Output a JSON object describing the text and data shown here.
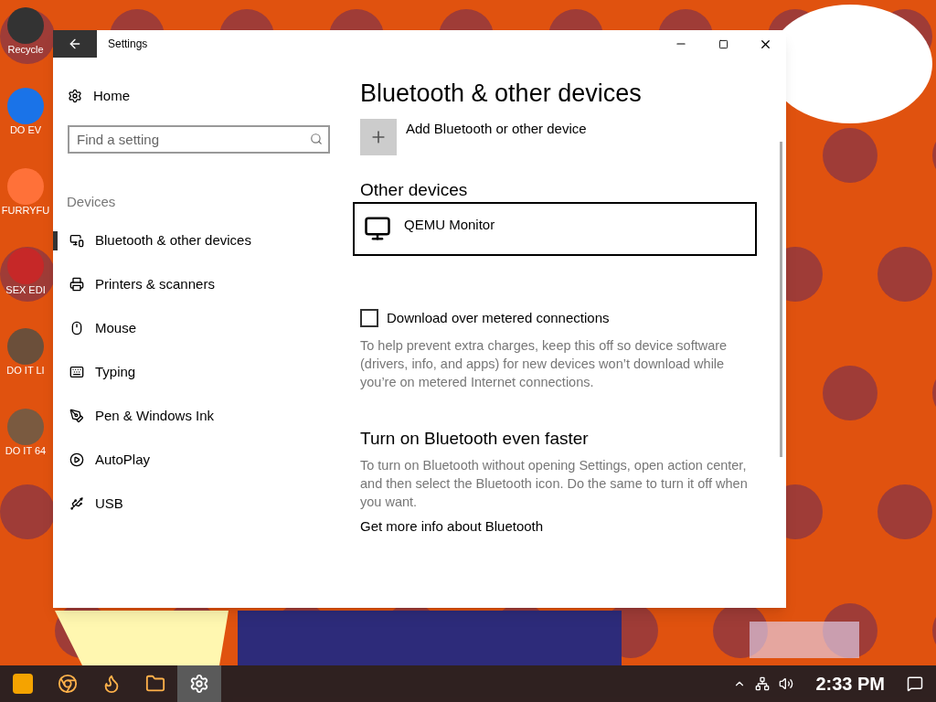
{
  "desktop": {
    "icons": [
      {
        "label": "Recycle"
      },
      {
        "label": "DO EV"
      },
      {
        "label": "FURRYFU"
      },
      {
        "label": "SEX EDI"
      },
      {
        "label": "DO IT LI"
      },
      {
        "label": "DO IT 64"
      }
    ]
  },
  "window": {
    "title": "Settings",
    "sidebar": {
      "home": "Home",
      "search": {
        "placeholder": "Find a setting"
      },
      "section": "Devices",
      "items": [
        {
          "label": "Bluetooth & other devices",
          "selected": true
        },
        {
          "label": "Printers & scanners",
          "selected": false
        },
        {
          "label": "Mouse",
          "selected": false
        },
        {
          "label": "Typing",
          "selected": false
        },
        {
          "label": "Pen & Windows Ink",
          "selected": false
        },
        {
          "label": "AutoPlay",
          "selected": false
        },
        {
          "label": "USB",
          "selected": false
        }
      ]
    },
    "content": {
      "title": "Bluetooth & other devices",
      "add_device": "Add Bluetooth or other device",
      "other_devices": {
        "heading": "Other devices",
        "devices": [
          {
            "name": "QEMU Monitor",
            "selected": true
          }
        ]
      },
      "metered": {
        "label": "Download over metered connections",
        "checked": false,
        "description": "To help prevent extra charges, keep this off so device software (drivers, info, and apps) for new devices won’t download while you’re on metered Internet connections."
      },
      "faster": {
        "heading": "Turn on Bluetooth even faster",
        "description": "To turn on Bluetooth without opening Settings, open action center, and then select the Bluetooth icon. Do the same to turn it off when you want.",
        "link": "Get more info about Bluetooth"
      }
    }
  },
  "taskbar": {
    "apps": [
      {
        "selected": false
      },
      {
        "selected": false
      },
      {
        "selected": false
      },
      {
        "selected": true
      }
    ],
    "clock": "2:33 PM"
  }
}
